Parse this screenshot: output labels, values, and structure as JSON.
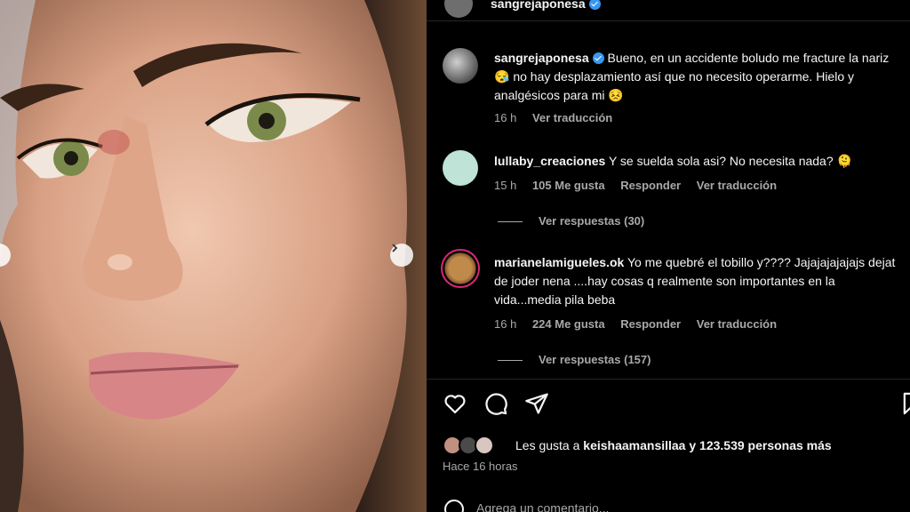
{
  "header": {
    "username": "sangrejaponesa"
  },
  "caption": {
    "username": "sangrejaponesa",
    "text": "Bueno, en un accidente boludo me fracture la nariz 😪 no hay desplazamiento así que no necesito operarme. Hielo y analgésicos para mi 😣",
    "time": "16 h",
    "translate": "Ver traducción"
  },
  "comments": [
    {
      "username": "lullaby_creaciones",
      "text": "Y se suelda sola asi? No necesita nada? 🫠",
      "time": "15 h",
      "likes": "105 Me gusta",
      "reply": "Responder",
      "translate": "Ver traducción",
      "replies": "Ver respuestas (30)"
    },
    {
      "username": "marianelamigueles.ok",
      "text": "Yo me quebré el tobillo y???? Jajajajajajajs dejat de joder nena ....hay cosas q realmente son importantes en la vida...media pila beba",
      "time": "16 h",
      "likes": "224 Me gusta",
      "reply": "Responder",
      "translate": "Ver traducción",
      "replies": "Ver respuestas (157)"
    }
  ],
  "likes": {
    "prefix": "Les gusta a",
    "user": "keishaamansillaa",
    "joiner": "y",
    "others": "123.539 personas más"
  },
  "posted": "Hace 16 horas",
  "add_comment_placeholder": "Agrega un comentario..."
}
